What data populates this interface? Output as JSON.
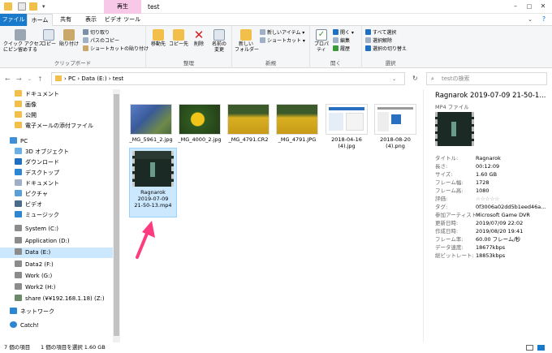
{
  "window": {
    "title": "test",
    "context_tab": "再生"
  },
  "tabs": [
    "ファイル",
    "ホーム",
    "共有",
    "表示",
    "ビデオ ツール"
  ],
  "ribbon": {
    "clipboard": {
      "label": "クリップボード",
      "pin": "クイック アクセス\nにピン留めする",
      "copy": "コピー",
      "paste": "貼り付け",
      "cut": "切り取り",
      "copy_path": "パスのコピー",
      "paste_shortcut": "ショートカットの貼り付け"
    },
    "organize": {
      "label": "整理",
      "move_to": "移動先",
      "copy_to": "コピー先",
      "delete": "削除",
      "rename": "名前の\n変更"
    },
    "new": {
      "label": "新規",
      "new_folder": "新しい\nフォルダー",
      "new_item": "新しいアイテム ▾",
      "shortcut": "ショートカット ▾"
    },
    "open": {
      "label": "開く",
      "properties": "プロパティ",
      "open": "開く ▾",
      "edit": "編集",
      "history": "履歴"
    },
    "select": {
      "label": "選択",
      "select_all": "すべて選択",
      "select_none": "選択解除",
      "invert": "選択の切り替え"
    }
  },
  "address": {
    "path": "›  PC  ›  Data (E:)  ›  test",
    "search_placeholder": "testの検索"
  },
  "sidebar": {
    "items": [
      {
        "label": "ドキュメント",
        "icon": "folder-icon"
      },
      {
        "label": "画像",
        "icon": "folder-icon"
      },
      {
        "label": "公開",
        "icon": "folder-icon"
      },
      {
        "label": "電子メールの添付ファイル",
        "icon": "folder-icon"
      },
      {
        "label": "PC",
        "icon": "pc-icon"
      },
      {
        "label": "3D オブジェクト",
        "icon": "cube-icon"
      },
      {
        "label": "ダウンロード",
        "icon": "download-icon"
      },
      {
        "label": "デスクトップ",
        "icon": "desktop-icon"
      },
      {
        "label": "ドキュメント",
        "icon": "document-icon"
      },
      {
        "label": "ピクチャ",
        "icon": "picture-icon"
      },
      {
        "label": "ビデオ",
        "icon": "video-icon"
      },
      {
        "label": "ミュージック",
        "icon": "music-icon"
      },
      {
        "label": "System (C:)",
        "icon": "drive-icon"
      },
      {
        "label": "Application (D:)",
        "icon": "drive-icon"
      },
      {
        "label": "Data (E:)",
        "icon": "drive-icon"
      },
      {
        "label": "Data2 (F:)",
        "icon": "drive-icon"
      },
      {
        "label": "Work (G:)",
        "icon": "drive-icon"
      },
      {
        "label": "Work2 (H:)",
        "icon": "drive-icon"
      },
      {
        "label": "share (¥¥192.168.1.18) (Z:)",
        "icon": "network-drive-icon"
      },
      {
        "label": "ネットワーク",
        "icon": "network-icon"
      },
      {
        "label": "Catch!",
        "icon": "catch-icon"
      }
    ]
  },
  "files": [
    {
      "name": "_MG_5961_2.jpg",
      "thumb": "flowers-photo"
    },
    {
      "name": "_MG_4000_2.jpg",
      "thumb": "sunflower-photo"
    },
    {
      "name": "_MG_4791.CR2",
      "thumb": "sunflower-field-photo"
    },
    {
      "name": "_MG_4791.JPG",
      "thumb": "sunflower-field-photo"
    },
    {
      "name": "2018-04-16\n(4).jpg",
      "thumb": "screenshot"
    },
    {
      "name": "2018-08-20\n(4).png",
      "thumb": "screenshot"
    },
    {
      "name": "Ragnarok\n2019-07-09\n21-50-13.mp4",
      "thumb": "video"
    }
  ],
  "details": {
    "title": "Ragnarok 2019-07-09 21-50-1...",
    "type": "MP4 ファイル",
    "props": [
      {
        "k": "タイトル:",
        "v": "Ragnarok"
      },
      {
        "k": "長さ:",
        "v": "00:12:09"
      },
      {
        "k": "サイズ:",
        "v": "1.60 GB"
      },
      {
        "k": "フレーム幅:",
        "v": "1728"
      },
      {
        "k": "フレーム高:",
        "v": "1080"
      },
      {
        "k": "評価:",
        "v": "☆☆☆☆☆"
      },
      {
        "k": "タグ:",
        "v": "0f3006a02dd5b1eed46a..."
      },
      {
        "k": "参加アーティスト:",
        "v": "Microsoft Game DVR"
      },
      {
        "k": "更新日時:",
        "v": "2019/07/09 22:02"
      },
      {
        "k": "作成日時:",
        "v": "2019/08/20 19:41"
      },
      {
        "k": "フレーム率:",
        "v": "60.00 フレーム/秒"
      },
      {
        "k": "データ速度:",
        "v": "18677kbps"
      },
      {
        "k": "総ビットレート:",
        "v": "18853kbps"
      }
    ]
  },
  "status": {
    "count": "7 個の項目",
    "selected": "1 個の項目を選択  1.60 GB"
  },
  "colors": {
    "accent": "#1979ca",
    "selection": "#cce8ff",
    "context_tab": "#f7c8e7",
    "arrow": "#ff3b80"
  }
}
